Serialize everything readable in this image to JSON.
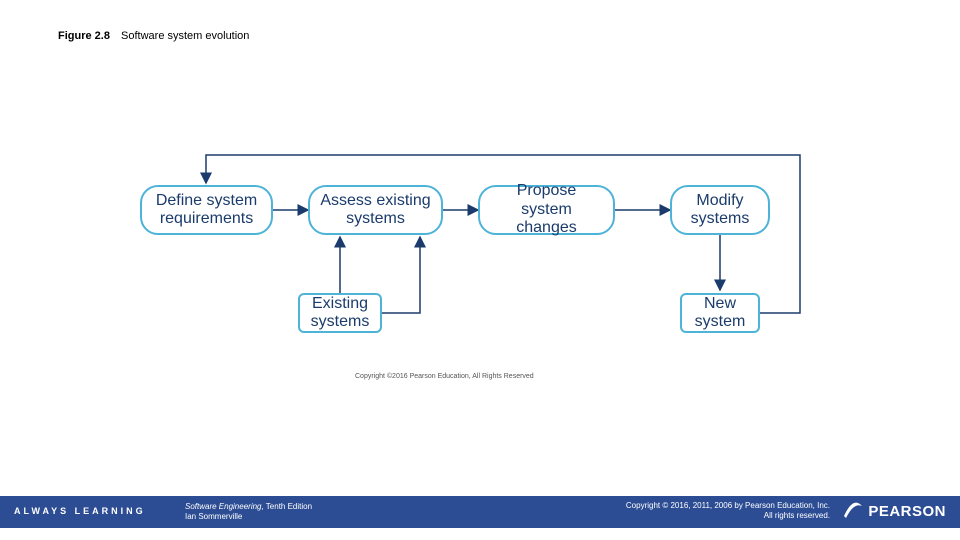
{
  "caption": {
    "figure_no": "Figure 2.8",
    "title": "Software system evolution"
  },
  "nodes": {
    "define": {
      "label": "Define system\nrequirements"
    },
    "assess": {
      "label": "Assess existing\nsystems"
    },
    "propose": {
      "label": "Propose system\nchanges"
    },
    "modify": {
      "label": "Modify\nsystems"
    },
    "existing": {
      "label": "Existing\nsystems"
    },
    "new": {
      "label": "New\nsystem"
    }
  },
  "diagram_copyright": "Copyright ©2016 Pearson Education, All Rights Reserved",
  "footer": {
    "always": "ALWAYS LEARNING",
    "book_title": "Software Engineering",
    "book_edition": ", Tenth Edition",
    "author": "Ian Sommerville",
    "copyright_line1": "Copyright © 2016, 2011, 2006 by Pearson Education, Inc.",
    "copyright_line2": "All rights reserved.",
    "brand": "PEARSON"
  },
  "chart_data": {
    "type": "flow_diagram",
    "title": "Software system evolution",
    "nodes": [
      {
        "id": "define",
        "label": "Define system requirements",
        "row": "top"
      },
      {
        "id": "assess",
        "label": "Assess existing systems",
        "row": "top"
      },
      {
        "id": "propose",
        "label": "Propose system changes",
        "row": "top"
      },
      {
        "id": "modify",
        "label": "Modify systems",
        "row": "top"
      },
      {
        "id": "existing",
        "label": "Existing systems",
        "row": "bottom"
      },
      {
        "id": "new",
        "label": "New system",
        "row": "bottom"
      }
    ],
    "edges": [
      {
        "from": "define",
        "to": "assess"
      },
      {
        "from": "assess",
        "to": "propose"
      },
      {
        "from": "propose",
        "to": "modify"
      },
      {
        "from": "existing",
        "to": "assess"
      },
      {
        "from": "existing",
        "to": "propose"
      },
      {
        "from": "modify",
        "to": "new"
      },
      {
        "from": "new",
        "to": "define",
        "feedback": true
      }
    ]
  }
}
